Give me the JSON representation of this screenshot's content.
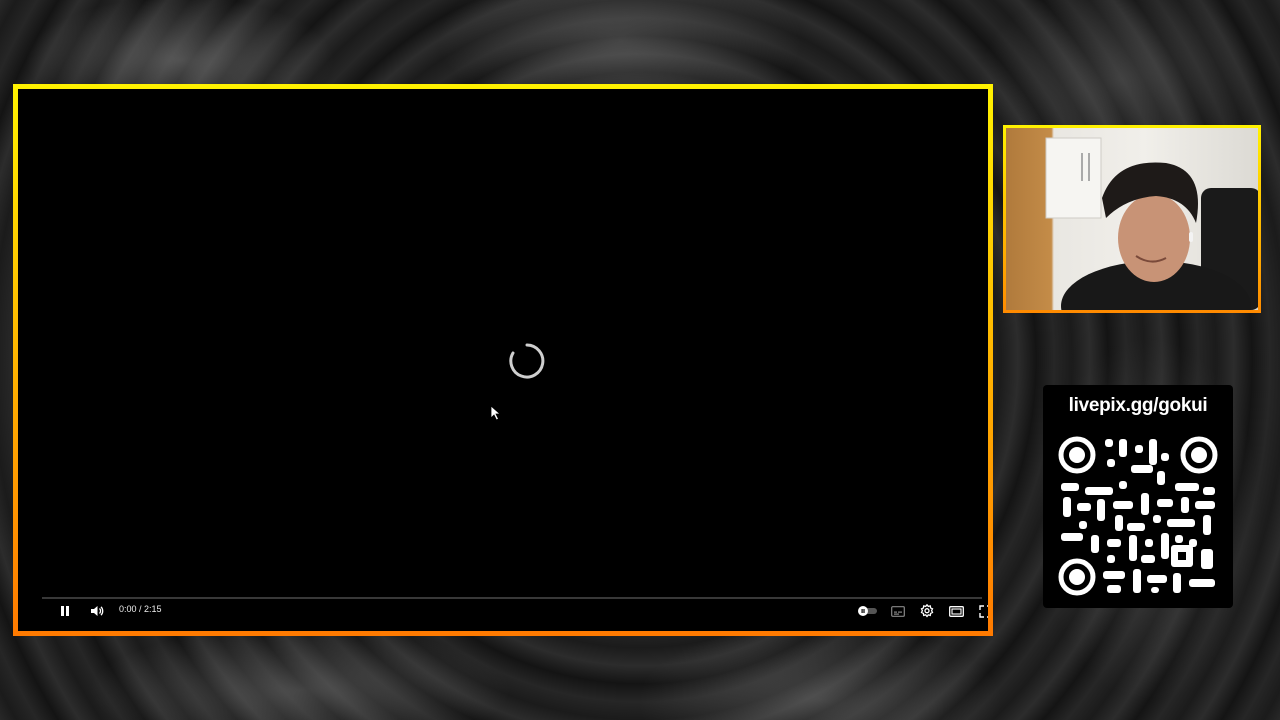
{
  "player": {
    "time_current": "0:00",
    "time_separator": " / ",
    "time_total": "2:15",
    "progress": 0,
    "loading": true,
    "controls_left": [
      "pause-icon",
      "volume-icon"
    ],
    "controls_right": [
      "autoplay-toggle-icon",
      "subtitles-icon",
      "settings-icon",
      "theater-mode-icon",
      "fullscreen-icon"
    ]
  },
  "webcam": {
    "label": ""
  },
  "donation": {
    "url_text": "livepix.gg/gokui",
    "qr_code": "qr-code-icon"
  },
  "colors": {
    "frame_top": "#fff200",
    "frame_bottom": "#ff7a00",
    "background": "#1c1c1c"
  }
}
